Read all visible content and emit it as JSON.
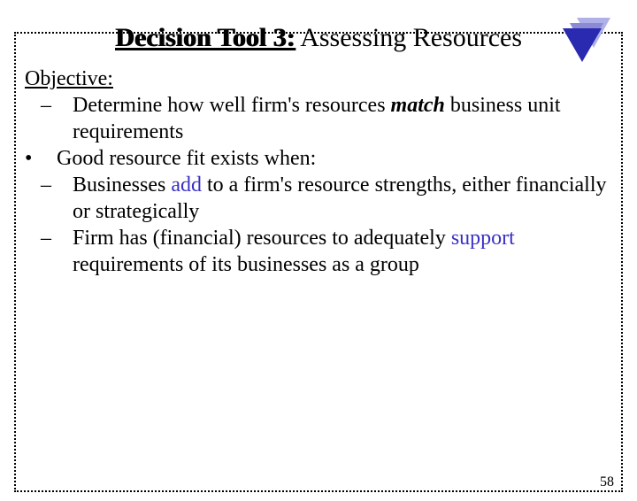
{
  "title": {
    "prefix": "Decision Tool 3:",
    "rest": " Assessing Resources"
  },
  "objective_label": "Objective:",
  "bullets": {
    "b1_pre": "Determine how well firm's resources ",
    "b1_kw": "match",
    "b1_post": " business unit requirements",
    "b2": "Good resource fit exists when:",
    "b3_pre": "Businesses ",
    "b3_kw": "add",
    "b3_post": " to a firm's resource strengths, either financially or strategically",
    "b4_pre": "Firm has (financial) resources to adequately ",
    "b4_kw": "support",
    "b4_post": " requirements of its businesses as a group"
  },
  "page_number": "58",
  "icons": {
    "corner": "triangle-stack-icon"
  }
}
